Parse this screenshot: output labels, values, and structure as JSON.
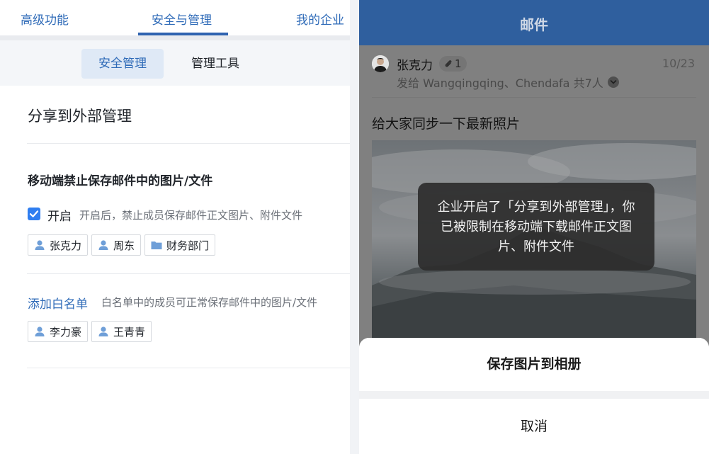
{
  "admin": {
    "top_tabs": [
      {
        "label": "高级功能",
        "active": false
      },
      {
        "label": "安全与管理",
        "active": true
      },
      {
        "label": "我的企业",
        "active": false
      }
    ],
    "sub_tabs": [
      {
        "label": "安全管理",
        "active": true
      },
      {
        "label": "管理工具",
        "active": false
      }
    ],
    "section_title": "分享到外部管理",
    "rule": {
      "title": "移动端禁止保存邮件中的图片/文件",
      "enabled": true,
      "enable_label": "开启",
      "enable_desc": "开启后，禁止成员保存邮件正文图片、附件文件",
      "scope_chips": [
        {
          "type": "user",
          "icon": "user-icon",
          "label": "张克力"
        },
        {
          "type": "user",
          "icon": "user-icon",
          "label": "周东"
        },
        {
          "type": "department",
          "icon": "folder-icon",
          "label": "财务部门"
        }
      ]
    },
    "whitelist": {
      "link_label": "添加白名单",
      "desc": "白名单中的成员可正常保存邮件中的图片/文件",
      "chips": [
        {
          "type": "user",
          "icon": "user-icon",
          "label": "李力豪"
        },
        {
          "type": "user",
          "icon": "user-icon",
          "label": "王青青"
        }
      ]
    }
  },
  "mobile": {
    "header_title": "邮件",
    "sender": "张克力",
    "attachment_count": "1",
    "date": "10/23",
    "recipients": "发给 Wangqingqing、Chendafa 共7人",
    "subject": "给大家同步一下最新照片",
    "toast": "企业开启了「分享到外部管理」，你已被限制在移动端下载邮件正文图片、附件文件",
    "sheet": {
      "save_label": "保存图片到相册",
      "cancel_label": "取消"
    }
  },
  "colors": {
    "accent": "#2f6bb8",
    "checkbox": "#2f7ef0",
    "phone_header": "#2f5f9e",
    "subtab_active_bg": "#dfe9f6"
  }
}
